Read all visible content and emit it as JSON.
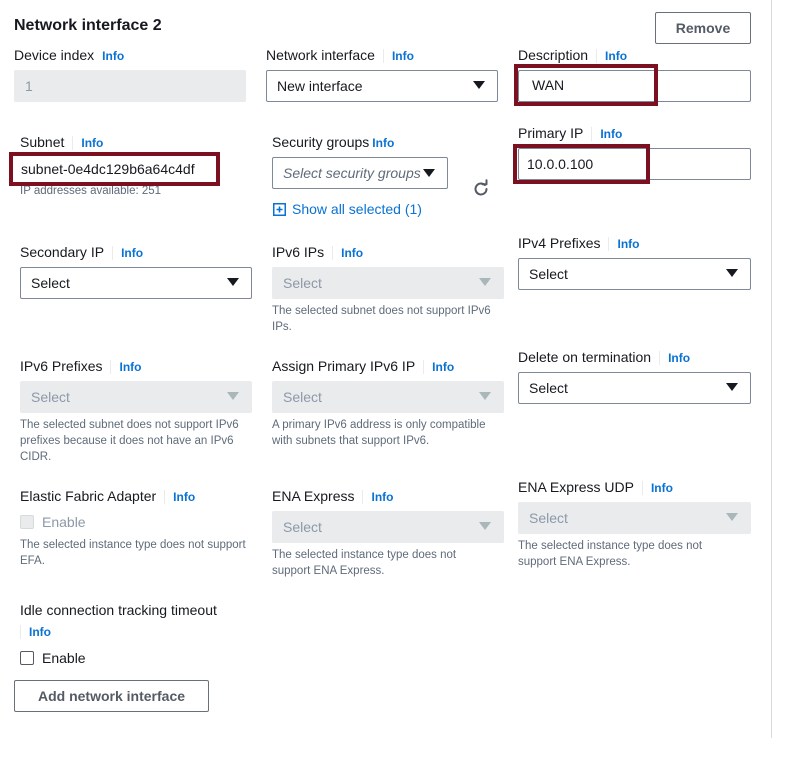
{
  "section": {
    "title": "Network interface 2",
    "remove_label": "Remove",
    "add_interface_label": "Add network interface"
  },
  "common": {
    "info": "Info"
  },
  "fields": {
    "device_index": {
      "label": "Device index",
      "value": "1"
    },
    "network_interface": {
      "label": "Network interface",
      "value": "New interface"
    },
    "description": {
      "label": "Description",
      "value": "WAN"
    },
    "subnet": {
      "label": "Subnet",
      "value": "subnet-0e4dc129b6a64c4df",
      "help": "IP addresses available: 251"
    },
    "security_groups": {
      "label": "Security groups",
      "placeholder": "Select security groups",
      "show_all": "Show all selected (1)"
    },
    "primary_ip": {
      "label": "Primary IP",
      "value": "10.0.0.100"
    },
    "secondary_ip": {
      "label": "Secondary IP",
      "value": "Select"
    },
    "ipv6_ips": {
      "label": "IPv6 IPs",
      "value": "Select",
      "help": "The selected subnet does not support IPv6 IPs."
    },
    "ipv4_prefixes": {
      "label": "IPv4 Prefixes",
      "value": "Select"
    },
    "ipv6_prefixes": {
      "label": "IPv6 Prefixes",
      "value": "Select",
      "help": "The selected subnet does not support IPv6 prefixes because it does not have an IPv6 CIDR."
    },
    "assign_primary_ipv6": {
      "label": "Assign Primary IPv6 IP",
      "value": "Select",
      "help": "A primary IPv6 address is only compatible with subnets that support IPv6."
    },
    "delete_on_termination": {
      "label": "Delete on termination",
      "value": "Select"
    },
    "efa": {
      "label": "Elastic Fabric Adapter",
      "checkbox": "Enable",
      "help": "The selected instance type does not support EFA."
    },
    "ena_express": {
      "label": "ENA Express",
      "value": "Select",
      "help": "The selected instance type does not support ENA Express."
    },
    "ena_express_udp": {
      "label": "ENA Express UDP",
      "value": "Select",
      "help": "The selected instance type does not support ENA Express."
    },
    "idle_timeout": {
      "label": "Idle connection tracking timeout",
      "checkbox": "Enable"
    }
  },
  "colors": {
    "info_link": "#0972d3",
    "highlight": "#7b1020",
    "disabled_bg": "#e9ebed"
  },
  "icons": {
    "refresh": "refresh-icon",
    "expand": "plus-square-icon",
    "caret": "caret-down-icon"
  }
}
